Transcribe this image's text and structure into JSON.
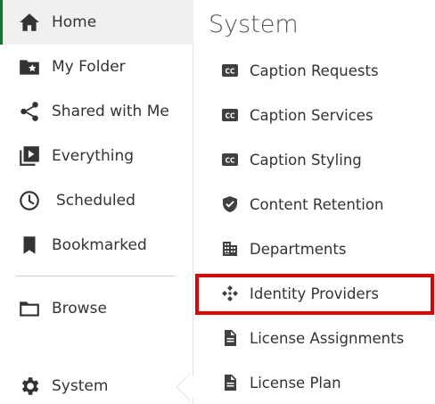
{
  "nav": {
    "items": [
      {
        "label": "Home",
        "icon": "home-icon",
        "active": true
      },
      {
        "label": "My Folder",
        "icon": "folder-star-icon"
      },
      {
        "label": "Shared with Me",
        "icon": "share-icon"
      },
      {
        "label": "Everything",
        "icon": "video-library-icon"
      },
      {
        "label": "Scheduled",
        "icon": "clock-icon"
      },
      {
        "label": "Bookmarked",
        "icon": "bookmark-icon"
      },
      {
        "label": "Browse",
        "icon": "folder-icon"
      },
      {
        "label": "System",
        "icon": "gear-icon"
      }
    ]
  },
  "panel": {
    "title": "System",
    "items": [
      {
        "label": "Caption Requests",
        "icon": "cc-icon"
      },
      {
        "label": "Caption Services",
        "icon": "cc-icon"
      },
      {
        "label": "Caption Styling",
        "icon": "cc-icon"
      },
      {
        "label": "Content Retention",
        "icon": "shield-check-icon"
      },
      {
        "label": "Departments",
        "icon": "building-icon"
      },
      {
        "label": "Identity Providers",
        "icon": "identity-providers-icon",
        "highlighted": true
      },
      {
        "label": "License Assignments",
        "icon": "document-icon"
      },
      {
        "label": "License Plan",
        "icon": "document-icon"
      }
    ]
  },
  "colors": {
    "active_accent": "#1e6e37",
    "active_background": "#f0f0f0",
    "highlight_border": "#e00000",
    "text": "#333333"
  }
}
